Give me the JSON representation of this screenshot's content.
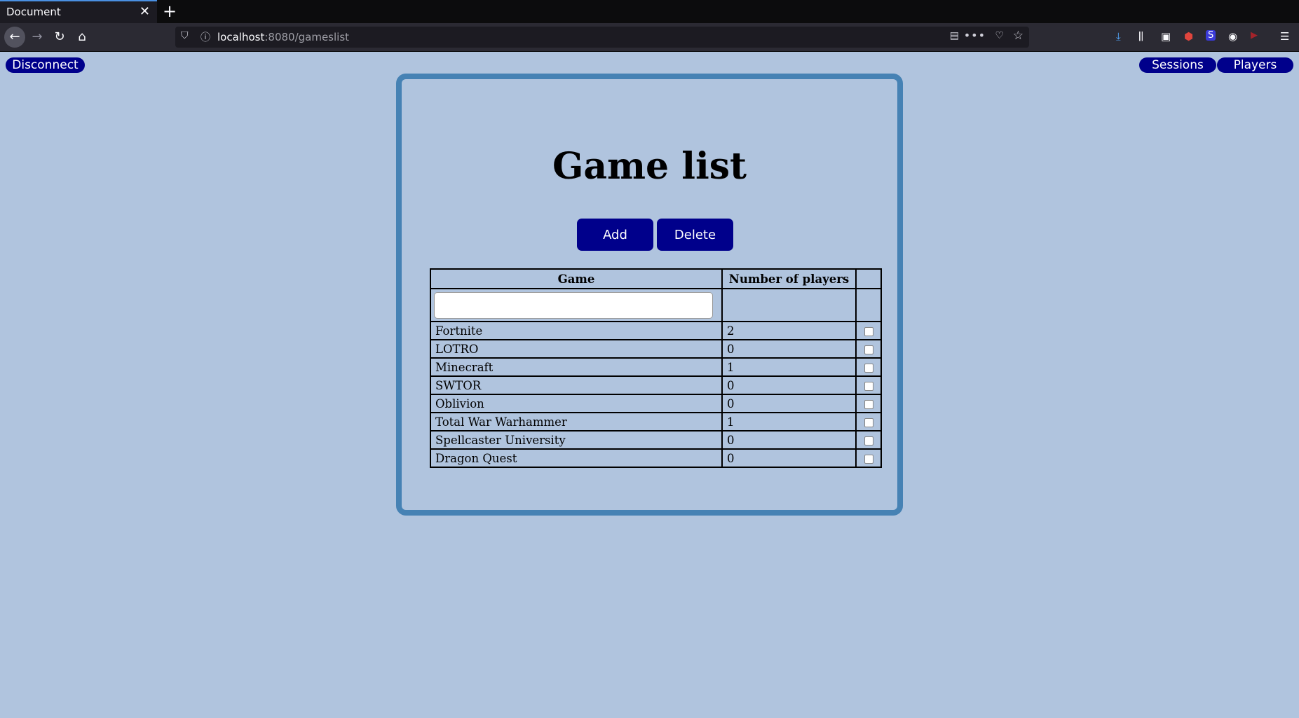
{
  "browser": {
    "tab_title": "Document",
    "url_host": "localhost",
    "url_rest": ":8080/gameslist"
  },
  "nav": {
    "disconnect": "Disconnect",
    "sessions": "Sessions",
    "players": "Players"
  },
  "page": {
    "title": "Game list",
    "add_label": "Add",
    "delete_label": "Delete",
    "filter_value": ""
  },
  "table": {
    "headers": [
      "Game",
      "Number of players",
      ""
    ],
    "rows": [
      {
        "game": "Fortnite",
        "players": "2",
        "checked": false
      },
      {
        "game": "LOTRO",
        "players": "0",
        "checked": false
      },
      {
        "game": "Minecraft",
        "players": "1",
        "checked": false
      },
      {
        "game": "SWTOR",
        "players": "0",
        "checked": false
      },
      {
        "game": "Oblivion",
        "players": "0",
        "checked": false
      },
      {
        "game": "Total War Warhammer",
        "players": "1",
        "checked": false
      },
      {
        "game": "Spellcaster University",
        "players": "0",
        "checked": false
      },
      {
        "game": "Dragon Quest",
        "players": "0",
        "checked": false
      }
    ]
  },
  "colors": {
    "page_bg": "#b0c4de",
    "card_border": "#4682b4",
    "button_bg": "#00008b"
  }
}
